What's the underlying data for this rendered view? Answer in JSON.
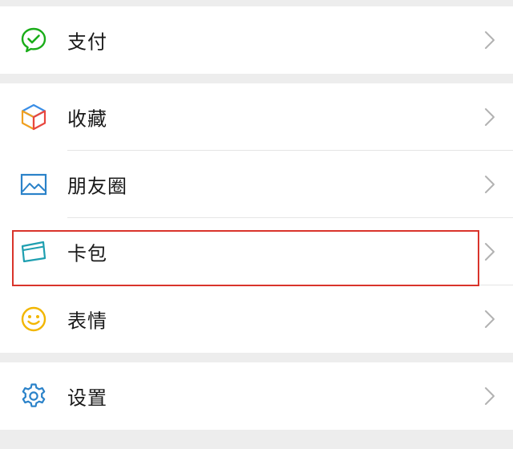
{
  "colors": {
    "background": "#ededed",
    "cell": "#ffffff",
    "text": "#191919",
    "divider": "#e5e5e5",
    "chevron": "#b2b2b2",
    "highlight": "#d9342b"
  },
  "menu": {
    "pay": {
      "label": "支付",
      "icon": "pay-icon"
    },
    "favorites": {
      "label": "收藏",
      "icon": "favorites-cube-icon"
    },
    "moments": {
      "label": "朋友圈",
      "icon": "moments-picture-icon"
    },
    "card_package": {
      "label": "卡包",
      "icon": "card-package-icon",
      "highlighted": true
    },
    "stickers": {
      "label": "表情",
      "icon": "smiley-icon"
    },
    "settings": {
      "label": "设置",
      "icon": "gear-icon"
    }
  }
}
